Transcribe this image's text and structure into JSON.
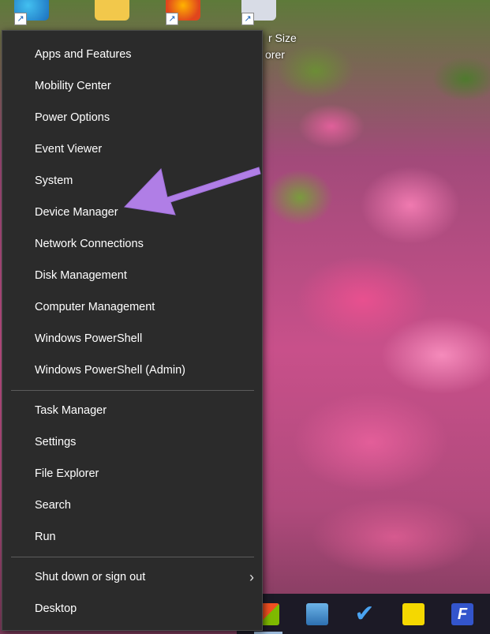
{
  "desktop": {
    "icon_label_line1": "r Size",
    "icon_label_line2": "orer"
  },
  "menu": {
    "items_group1": [
      "Apps and Features",
      "Mobility Center",
      "Power Options",
      "Event Viewer",
      "System",
      "Device Manager",
      "Network Connections",
      "Disk Management",
      "Computer Management",
      "Windows PowerShell",
      "Windows PowerShell (Admin)"
    ],
    "items_group2": [
      "Task Manager",
      "Settings",
      "File Explorer",
      "Search",
      "Run"
    ],
    "items_group3": [
      "Shut down or sign out",
      "Desktop"
    ],
    "submenu_chevron": "›"
  },
  "taskbar": {
    "f_icon_letter": "F",
    "check_icon_glyph": "✔"
  },
  "colors": {
    "menu_bg": "#2b2b2b",
    "menu_text": "#ffffff",
    "separator": "#5c5c5c",
    "annotation_arrow": "#b07ee6"
  },
  "icons": [
    "edge-icon",
    "folder-icon",
    "firefox-icon",
    "file-icon",
    "store-icon",
    "pc-icon",
    "check-icon",
    "sticky-note-icon",
    "f-app-icon",
    "chevron-right-icon",
    "annotation-arrow-icon"
  ]
}
